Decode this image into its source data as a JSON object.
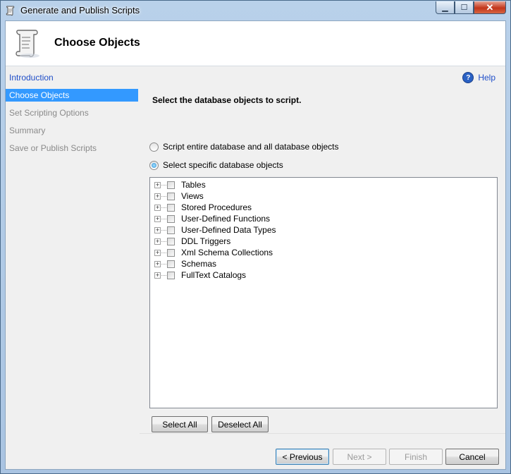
{
  "window": {
    "title": "Generate and Publish Scripts"
  },
  "header": {
    "title": "Choose Objects"
  },
  "nav": {
    "items": [
      {
        "label": "Introduction",
        "state": "link"
      },
      {
        "label": "Choose Objects",
        "state": "selected"
      },
      {
        "label": "Set Scripting Options",
        "state": "disabled"
      },
      {
        "label": "Summary",
        "state": "disabled"
      },
      {
        "label": "Save or Publish Scripts",
        "state": "disabled"
      }
    ]
  },
  "help": {
    "label": "Help"
  },
  "main": {
    "instruction": "Select the database objects to script.",
    "radio_entire": {
      "label": "Script entire database and all database objects",
      "checked": false
    },
    "radio_specific": {
      "label": "Select specific database objects",
      "checked": true
    },
    "tree": [
      {
        "label": "Tables"
      },
      {
        "label": "Views"
      },
      {
        "label": "Stored Procedures"
      },
      {
        "label": "User-Defined Functions"
      },
      {
        "label": "User-Defined Data Types"
      },
      {
        "label": "DDL Triggers"
      },
      {
        "label": "Xml Schema Collections"
      },
      {
        "label": "Schemas"
      },
      {
        "label": "FullText Catalogs"
      }
    ],
    "select_all_label": "Select All",
    "deselect_all_label": "Deselect All"
  },
  "footer": {
    "previous_label": "< Previous",
    "next_label": "Next >",
    "finish_label": "Finish",
    "cancel_label": "Cancel"
  },
  "colors": {
    "selection": "#3399ff",
    "link": "#1f4ec8",
    "panel": "#f0f0f0"
  }
}
